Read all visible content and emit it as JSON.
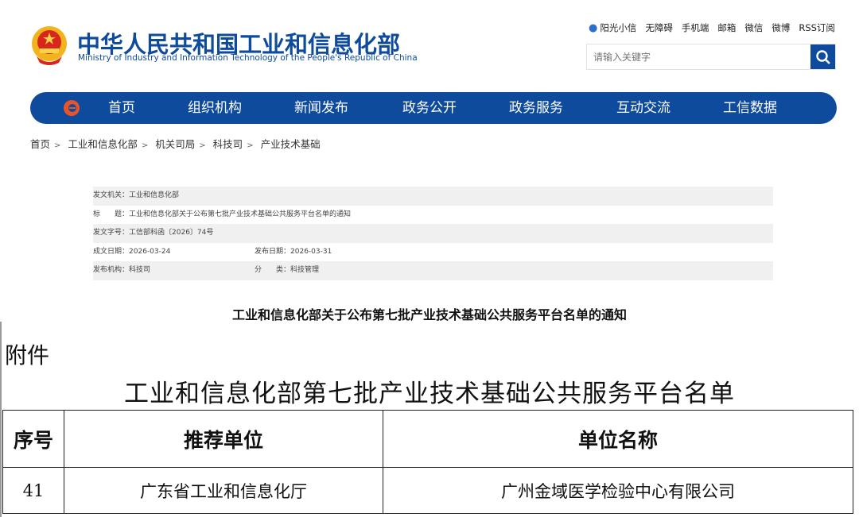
{
  "header": {
    "title": "中华人民共和国工业和信息化部",
    "subtitle": "Ministry of Industry and Information Technology of the People's Republic of China",
    "top_links": [
      "阳光小信",
      "无障碍",
      "手机端",
      "邮箱",
      "微信",
      "微博",
      "RSS订阅"
    ],
    "search_placeholder": "请输入关键字"
  },
  "nav": {
    "items": [
      "首页",
      "组织机构",
      "新闻发布",
      "政务公开",
      "政务服务",
      "互动交流",
      "工信数据"
    ]
  },
  "breadcrumb": [
    "首页",
    "工业和信息化部",
    "机关司局",
    "科技司",
    "产业技术基础"
  ],
  "meta": {
    "issuer_label": "发文机关：",
    "issuer": "工业和信息化部",
    "title_label": "标　　题：",
    "title": "工业和信息化部关于公布第七批产业技术基础公共服务平台名单的通知",
    "docno_label": "发文字号：",
    "docno": "工信部科函〔2026〕74号",
    "written_label": "成文日期：",
    "written": "2026-03-24",
    "published_label": "发布日期：",
    "published": "2026-03-31",
    "org_label": "发布机构：",
    "org": "科技司",
    "category_label": "分　　类：",
    "category": "科技管理"
  },
  "doc_title": "工业和信息化部关于公布第七批产业技术基础公共服务平台名单的通知",
  "attachment": {
    "label": "附件",
    "title": "工业和信息化部第七批产业技术基础公共服务平台名单",
    "headers": [
      "序号",
      "推荐单位",
      "单位名称"
    ],
    "rows": [
      [
        "41",
        "广东省工业和信息化厅",
        "广州金域医学检验中心有限公司"
      ]
    ]
  },
  "colors": {
    "brand": "#0f4b9c"
  }
}
